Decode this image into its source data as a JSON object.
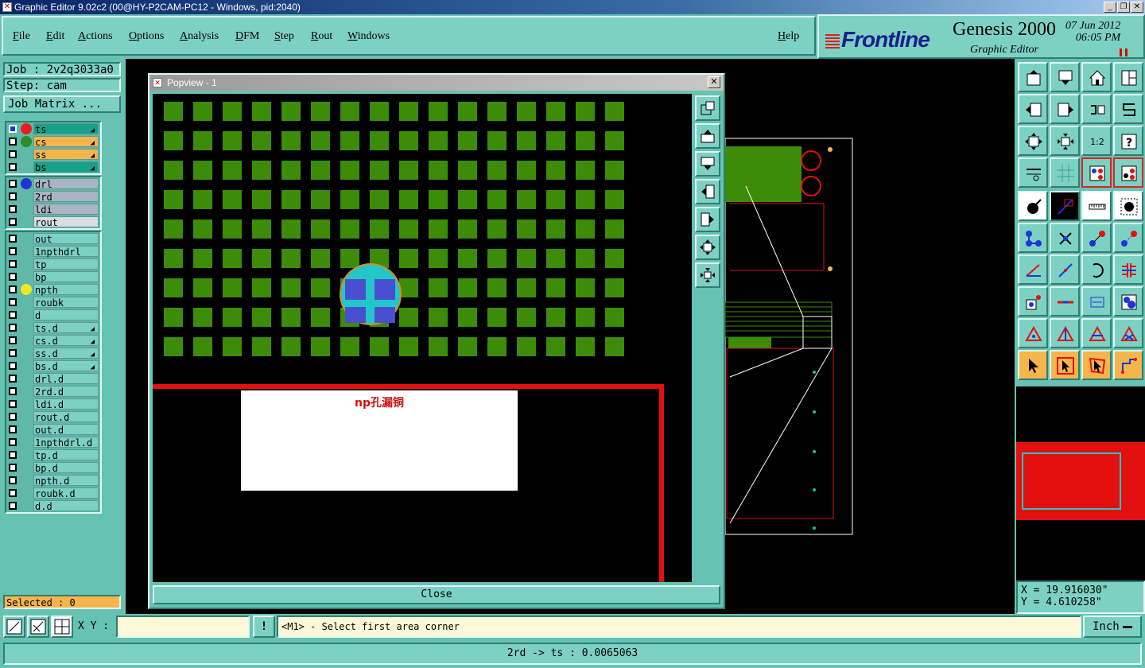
{
  "window": {
    "title": "Graphic Editor 9.02c2 (00@HY-P2CAM-PC12 - Windows, pid:2040)"
  },
  "menu": {
    "items": [
      "File",
      "Edit",
      "Actions",
      "Options",
      "Analysis",
      "DFM",
      "Step",
      "Rout",
      "Windows"
    ],
    "help": "Help"
  },
  "brand": {
    "logo": "Frontline",
    "product": "Genesis 2000",
    "subtitle": "Graphic Editor",
    "date": "07 Jun 2012",
    "time": "06:05 PM"
  },
  "left": {
    "job_label": "Job : 2v2q3033a0",
    "step_label": "Step: cam",
    "job_matrix": "Job Matrix ...",
    "group1": [
      {
        "name": "ts",
        "color": "#19a08a",
        "dot": "#e81c1c",
        "active": true
      },
      {
        "name": "cs",
        "color": "#f6b44c",
        "dot": "#2e8b2e"
      },
      {
        "name": "ss",
        "color": "#f6b44c",
        "dot": ""
      },
      {
        "name": "bs",
        "color": "#19a08a",
        "dot": ""
      }
    ],
    "group2": [
      {
        "name": "drl",
        "color": "#a9b5c4",
        "dot": "#1b35d8"
      },
      {
        "name": "2rd",
        "color": "#a9b5c4",
        "dot": ""
      },
      {
        "name": "ldi",
        "color": "#a9b5c4",
        "dot": ""
      },
      {
        "name": "rout",
        "color": "#d9dde2",
        "dot": ""
      }
    ],
    "group3": [
      {
        "name": "out",
        "dot": ""
      },
      {
        "name": "1npthdrl",
        "dot": ""
      },
      {
        "name": "tp",
        "dot": ""
      },
      {
        "name": "bp",
        "dot": ""
      },
      {
        "name": "npth",
        "dot": "#f2e52a"
      },
      {
        "name": "roubk",
        "dot": ""
      },
      {
        "name": "d",
        "dot": ""
      },
      {
        "name": "ts.d",
        "dot": "",
        "flag": "◢"
      },
      {
        "name": "cs.d",
        "dot": "",
        "flag": "◢"
      },
      {
        "name": "ss.d",
        "dot": "",
        "flag": "◢"
      },
      {
        "name": "bs.d",
        "dot": "",
        "flag": "◢"
      },
      {
        "name": "drl.d",
        "dot": ""
      },
      {
        "name": "2rd.d",
        "dot": ""
      },
      {
        "name": "ldi.d",
        "dot": ""
      },
      {
        "name": "rout.d",
        "dot": ""
      },
      {
        "name": "out.d",
        "dot": ""
      },
      {
        "name": "1npthdrl.d",
        "dot": ""
      },
      {
        "name": "tp.d",
        "dot": ""
      },
      {
        "name": "bp.d",
        "dot": ""
      },
      {
        "name": "npth.d",
        "dot": ""
      },
      {
        "name": "roubk.d",
        "dot": ""
      },
      {
        "name": "d.d",
        "dot": ""
      }
    ],
    "selected": "Selected : 0"
  },
  "popview": {
    "title": "Popview - 1",
    "note": "np孔漏铜",
    "close": "Close"
  },
  "coords": {
    "x": "X = 19.916030\"",
    "y": "Y = 4.610258\""
  },
  "command": {
    "xy_label": "X Y :",
    "xy_value": "",
    "excl": "!",
    "prompt": "<M1> - Select first area corner",
    "units": "Inch"
  },
  "status": {
    "text": "2rd -> ts : 0.0065063"
  },
  "colors": {
    "panel": "#66c2b3",
    "panel_light": "#7dd1c3",
    "pad_green": "#3c8c0a",
    "highlight_red": "#e31010"
  }
}
